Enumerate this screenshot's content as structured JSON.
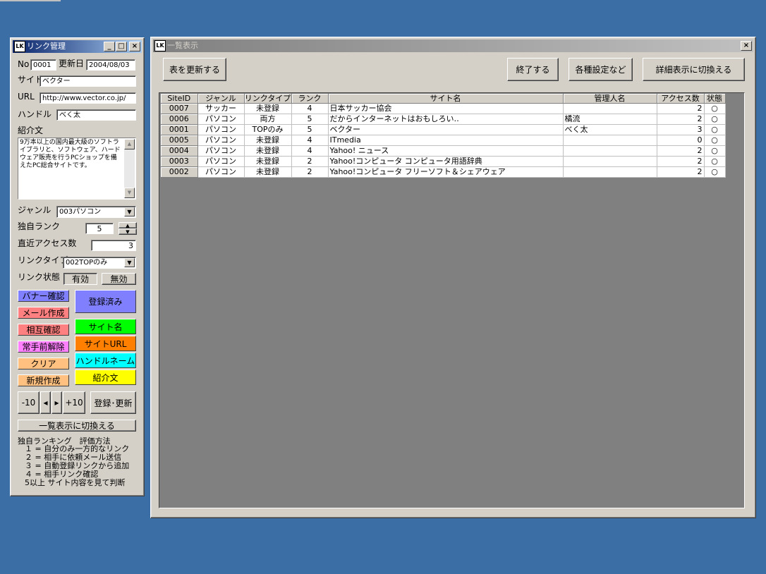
{
  "left_window": {
    "title": "リンク管理",
    "fields": {
      "no_label": "No",
      "no_value": "0001",
      "updated_label": "更新日",
      "updated_value": "2004/08/03",
      "site_label": "サイト",
      "site_value": "ベクター",
      "url_label": "URL",
      "url_value": "http://www.vector.co.jp/",
      "handle_label": "ハンドル",
      "handle_value": "べく太",
      "intro_label": "紹介文",
      "intro_value": "9万本以上の国内最大級のソフトライブラリと、ソフトウェア、ハードウェア販売を行うPCショップを備えたPC総合サイトです。",
      "genre_label": "ジャンル",
      "genre_value": "003パソコン",
      "rank_label": "独自ランク",
      "rank_value": "5",
      "access_label": "直近アクセス数",
      "access_value": "3",
      "linktype_label": "リンクタイプ",
      "linktype_value": "002TOPのみ",
      "status_label": "リンク状態",
      "status_valid": "有効",
      "status_invalid": "無効"
    },
    "buttons": {
      "banner": "バナー確認",
      "mail": "メール作成",
      "mutual": "相互確認",
      "release": "常手前解除",
      "clear": "クリア",
      "new": "新規作成",
      "registered": "登録済み",
      "site_name": "サイト名",
      "site_url": "サイトURL",
      "handle_name": "ハンドルネーム",
      "intro": "紹介文",
      "minus10": "-10",
      "prev": "◂",
      "next": "▸",
      "plus10": "+10",
      "register_update": "登録･更新",
      "switch_list": "一覧表示に切換える"
    },
    "colors": {
      "banner": "#8080ff",
      "mail": "#ff8080",
      "mutual": "#ff8080",
      "release": "#ff80ff",
      "clear": "#ffc080",
      "new": "#ffc080",
      "registered": "#8080ff",
      "site_name": "#00ff00",
      "site_url": "#ff8000",
      "handle_name": "#00ffff",
      "intro": "#ffff00"
    },
    "ranking": {
      "title": "独自ランキング　評価方法",
      "line1": "１ = 自分のみ一方的なリンク",
      "line2": "２ = 相手に依頼メール送信",
      "line3": "３ = 自動登録リンクから追加",
      "line4": "４ = 相手リンク確認",
      "line5": "5以上 サイト内容を見て判断"
    }
  },
  "right_window": {
    "title": "一覧表示",
    "buttons": {
      "refresh": "表を更新する",
      "exit": "終了する",
      "settings": "各種設定など",
      "detail": "詳細表示に切換える"
    },
    "columns": [
      "SiteID",
      "ジャンル",
      "リンクタイプ",
      "ランク",
      "サイト名",
      "管理人名",
      "アクセス数",
      "状態"
    ],
    "rows": [
      {
        "id": "0007",
        "genre": "サッカー",
        "type": "未登録",
        "rank": "4",
        "name": "日本サッカー協会",
        "admin": "",
        "access": "2",
        "state": "○"
      },
      {
        "id": "0006",
        "genre": "パソコン",
        "type": "両方",
        "rank": "5",
        "name": "だからインターネットはおもしろい‥",
        "admin": "橘流",
        "access": "2",
        "state": "○"
      },
      {
        "id": "0001",
        "genre": "パソコン",
        "type": "TOPのみ",
        "rank": "5",
        "name": "ベクター",
        "admin": "べく太",
        "access": "3",
        "state": "○"
      },
      {
        "id": "0005",
        "genre": "パソコン",
        "type": "未登録",
        "rank": "4",
        "name": "ITmedia",
        "admin": "",
        "access": "0",
        "state": "○"
      },
      {
        "id": "0004",
        "genre": "パソコン",
        "type": "未登録",
        "rank": "4",
        "name": "Yahoo! ニュース",
        "admin": "",
        "access": "2",
        "state": "○"
      },
      {
        "id": "0003",
        "genre": "パソコン",
        "type": "未登録",
        "rank": "2",
        "name": "Yahoo!コンピュータ コンピュータ用語辞典",
        "admin": "",
        "access": "2",
        "state": "○"
      },
      {
        "id": "0002",
        "genre": "パソコン",
        "type": "未登録",
        "rank": "2",
        "name": "Yahoo!コンピュータ フリーソフト＆シェアウェア",
        "admin": "",
        "access": "2",
        "state": "○"
      }
    ]
  }
}
